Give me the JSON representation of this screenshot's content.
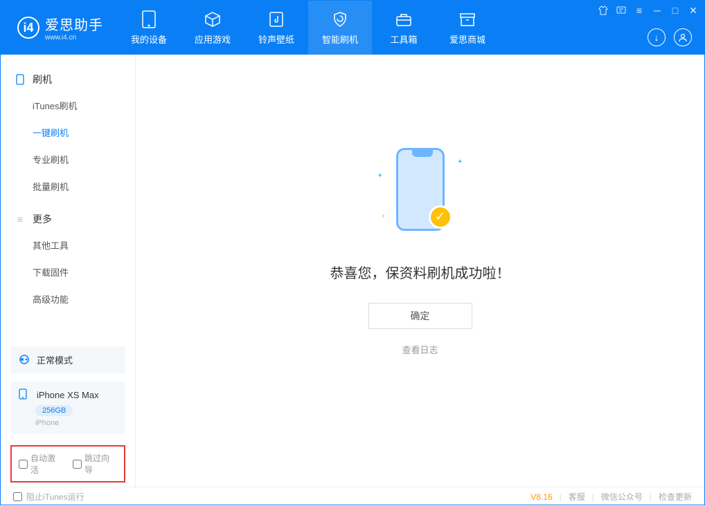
{
  "app": {
    "name": "爱思助手",
    "domain": "www.i4.cn"
  },
  "nav": {
    "tabs": [
      {
        "label": "我的设备"
      },
      {
        "label": "应用游戏"
      },
      {
        "label": "铃声壁纸"
      },
      {
        "label": "智能刷机"
      },
      {
        "label": "工具箱"
      },
      {
        "label": "爱思商城"
      }
    ]
  },
  "sidebar": {
    "section1_title": "刷机",
    "section1_items": [
      {
        "label": "iTunes刷机"
      },
      {
        "label": "一键刷机"
      },
      {
        "label": "专业刷机"
      },
      {
        "label": "批量刷机"
      }
    ],
    "section2_title": "更多",
    "section2_items": [
      {
        "label": "其他工具"
      },
      {
        "label": "下载固件"
      },
      {
        "label": "高级功能"
      }
    ],
    "mode_label": "正常模式",
    "device_name": "iPhone XS Max",
    "device_capacity": "256GB",
    "device_type": "iPhone",
    "chk_auto_activate": "自动激活",
    "chk_skip_guide": "跳过向导"
  },
  "main": {
    "success_text": "恭喜您，保资料刷机成功啦！",
    "confirm_btn": "确定",
    "log_link": "查看日志"
  },
  "footer": {
    "block_itunes": "阻止iTunes运行",
    "version": "V8.16",
    "support": "客服",
    "wechat": "微信公众号",
    "update": "检查更新"
  }
}
